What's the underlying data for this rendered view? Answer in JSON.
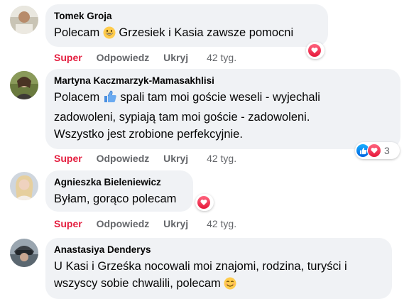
{
  "comments": [
    {
      "author": "Tomek Groja",
      "text_parts": [
        "Polecam",
        "Grzesiek i Kasia zawsze pomocni"
      ],
      "reaction_count": "",
      "time": "42 tyg."
    },
    {
      "author": "Martyna Kaczmarzyk-Mamasakhlisi",
      "text_parts": [
        "Polacem",
        "spali tam moi goście weseli - wyjechali",
        "zadowoleni, sypiają tam moi goście - zadowoleni.",
        "Wszystko jest zrobione perfekcyjnie."
      ],
      "reaction_count": "3",
      "time": "42 tyg."
    },
    {
      "author": "Agnieszka Bieleniewicz",
      "text_parts": [
        "Byłam, gorąco polecam"
      ],
      "reaction_count": "",
      "time": "42 tyg."
    },
    {
      "author": "Anastasiya Denderys",
      "text_parts": [
        "U Kasi i Grześka nocowali moi znajomi, rodzina, turyści i",
        "wszyscy sobie chwalili, polecam"
      ],
      "reaction_count": "",
      "time": ""
    }
  ],
  "actions": {
    "super": "Super",
    "reply": "Odpowiedz",
    "hide": "Ukryj"
  },
  "icons": {
    "smile_emoji": "grinning-face-icon",
    "thumbs_up_emoji": "thumbs-up-icon",
    "heart_reaction": "heart-reaction-icon",
    "like_reaction": "like-reaction-icon",
    "blush_emoji": "smiling-face-icon"
  },
  "colors": {
    "bubble_bg": "#f0f2f5",
    "super_red": "#e41e3f",
    "meta_gray": "#65676b",
    "like_blue": "#0866ff",
    "heart_red": "#f33e58"
  }
}
